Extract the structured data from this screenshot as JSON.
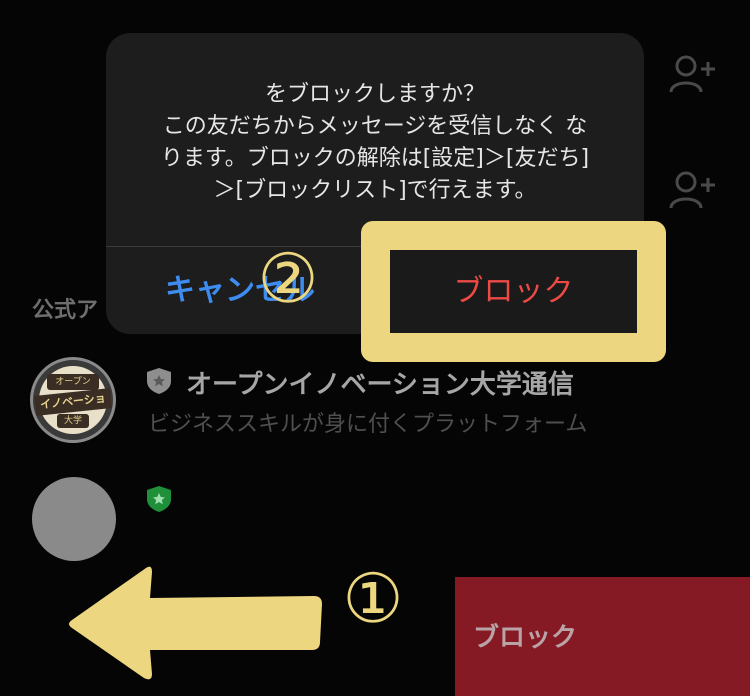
{
  "background": {
    "add_friend_icon": "person-plus",
    "section_label": "公式ア",
    "rows": [
      {
        "name": "オープンイノベーション大学通信",
        "subtitle": "ビジネススキルが身に付くプラットフォーム",
        "badge_color": "#8e8e8e",
        "avatar_text": [
          "オープン",
          "イノベーション",
          "大学"
        ]
      },
      {
        "name": "",
        "subtitle": "",
        "badge_color": "#1f8f3a"
      }
    ],
    "swipe_action": {
      "label": "ブロック",
      "color": "#861a24"
    }
  },
  "alert": {
    "message_lines": [
      "をブロックしますか？",
      "この友だちからメッセージを受信しなく な",
      "ります。ブロックの解除は[設定]＞[友だち]",
      "＞[ブロックリスト]で行えます。"
    ],
    "cancel_label": "キャンセル",
    "block_label": "ブロック",
    "cancel_color": "#3d8cf0",
    "block_color": "#ed4a46"
  },
  "annotations": {
    "step1": "①",
    "step2": "②",
    "highlight_color": "#ecd67f"
  }
}
